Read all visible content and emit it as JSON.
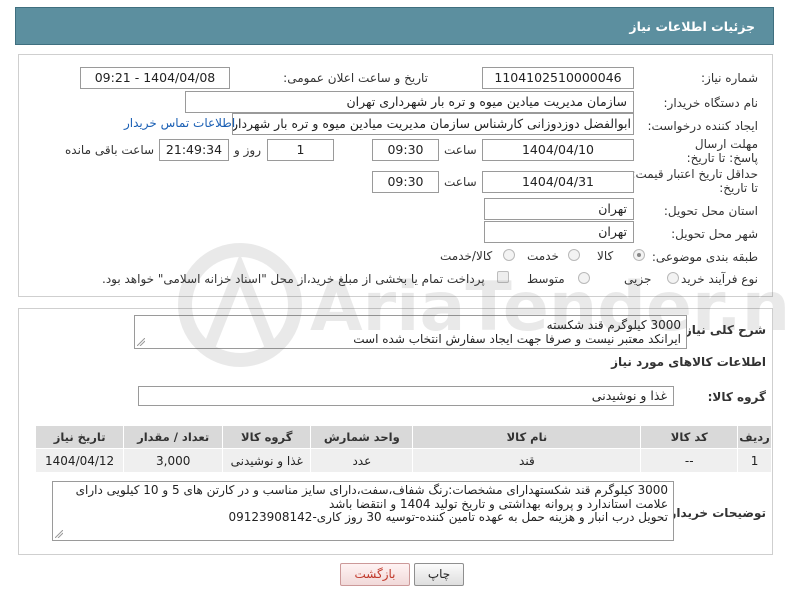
{
  "header": {
    "title": "جزئیات اطلاعات نیاز"
  },
  "fields": {
    "need_number_label": "شماره نیاز:",
    "need_number": "1104102510000046",
    "announce_label": "تاریخ و ساعت اعلان عمومی:",
    "announce_value": "1404/04/08 - 09:21",
    "buyer_org_label": "نام دستگاه خریدار:",
    "buyer_org": "سازمان مدیریت میادین میوه و تره بار شهرداری تهران",
    "requester_label": "ایجاد کننده درخواست:",
    "requester": "ابوالفضل دوزدوزانی کارشناس سازمان مدیریت میادین میوه و تره بار شهرداری تهران",
    "contact_link": "اطلاعات تماس خریدار",
    "deadline_label": "مهلت ارسال پاسخ: تا تاریخ:",
    "deadline_date": "1404/04/10",
    "time_label": "ساعت",
    "deadline_time": "09:30",
    "days_value": "1",
    "days_label": "روز و",
    "remaining_value": "21:49:34",
    "remaining_label": "ساعت باقی مانده",
    "validity_label": "حداقل تاریخ اعتبار قیمت: تا تاریخ:",
    "validity_date": "1404/04/31",
    "validity_time": "09:30",
    "province_label": "استان محل تحویل:",
    "province": "تهران",
    "city_label": "شهر محل تحویل:",
    "city": "تهران",
    "category_label": "طبقه بندی موضوعی:",
    "category_options": [
      "کالا",
      "خدمت",
      "کالا/خدمت"
    ],
    "process_label": "نوع فرآیند خرید :",
    "process_options": [
      "جزیی",
      "متوسط"
    ],
    "process_note": "پرداخت تمام یا بخشی از مبلغ خرید،از محل \"اسناد خزانه اسلامی\" خواهد بود."
  },
  "description": {
    "label": "شرح کلی نیاز:",
    "line1": "3000 کیلوگرم قند شکسته",
    "line2": "ایرانکد معتبر نیست و صرفا جهت ایجاد سفارش انتخاب شده است"
  },
  "goods": {
    "section_title": "اطلاعات کالاهای مورد نیاز",
    "group_label": "گروه کالا:",
    "group_value": "غذا و نوشیدنی"
  },
  "table": {
    "headers": [
      "ردیف",
      "کد کالا",
      "نام کالا",
      "واحد شمارش",
      "گروه کالا",
      "تعداد / مقدار",
      "تاریخ نیاز"
    ],
    "rows": [
      [
        "1",
        "--",
        "قند",
        "عدد",
        "غذا و نوشیدنی",
        "3,000",
        "1404/04/12"
      ]
    ]
  },
  "buyer_notes": {
    "label": "توضیحات خریدار:",
    "line1": "3000 کیلوگرم قند شکستهدارای مشخصات:رنگ شفاف،سفت،دارای سایز مناسب و در کارتن های 5 و 10 کیلویی دارای",
    "line2": "علامت استاندارد و پروانه بهداشتی و تاریخ تولید 1404 و انتقضا باشد",
    "line3": "تحویل درب انبار و هزینه حمل به عهده تامین کننده-توسیه 30 روز کاری-09123908142"
  },
  "buttons": {
    "print": "چاپ",
    "back": "بازگشت"
  },
  "watermark": {
    "text": "AriaTender.neT"
  },
  "colors": {
    "header": "#5c8f9f",
    "link": "#1a5fb4",
    "table_header": "#d9d9d9"
  }
}
